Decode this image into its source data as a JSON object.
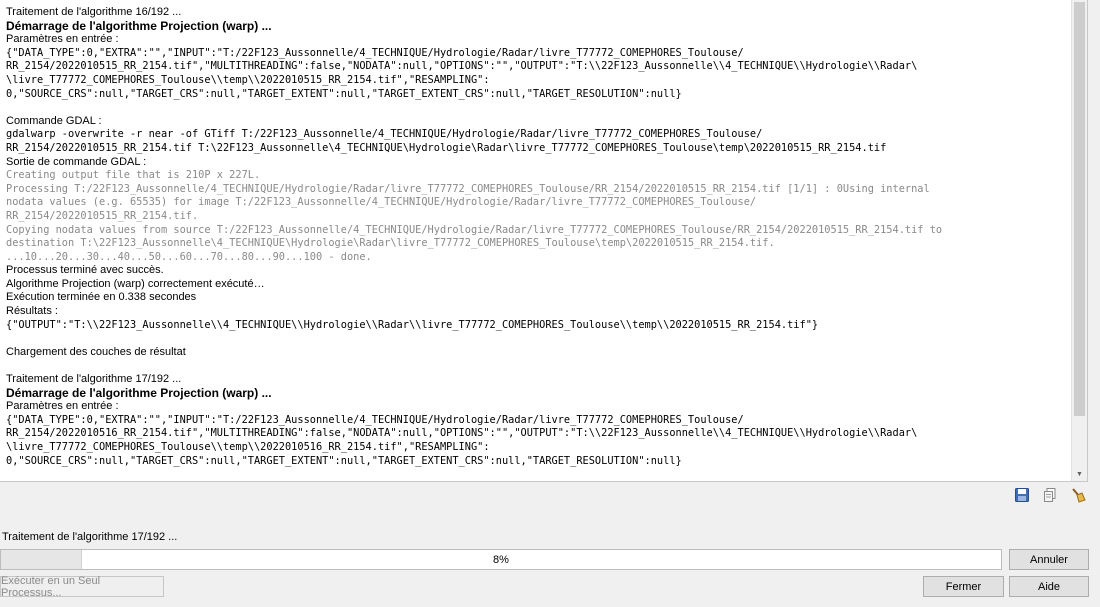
{
  "log": {
    "lines": [
      {
        "t": "Traitement de l'algorithme 16/192 ...",
        "s": "text"
      },
      {
        "t": "Démarrage de l'algorithme Projection (warp) ...",
        "s": "head"
      },
      {
        "t": "Paramètres en entrée :",
        "s": "text"
      },
      {
        "t": "{\"DATA_TYPE\":0,\"EXTRA\":\"\",\"INPUT\":\"T:/22F123_Aussonnelle/4_TECHNIQUE/Hydrologie/Radar/livre_T77772_COMEPHORES_Toulouse/",
        "s": "mono"
      },
      {
        "t": "RR_2154/2022010515_RR_2154.tif\",\"MULTITHREADING\":false,\"NODATA\":null,\"OPTIONS\":\"\",\"OUTPUT\":\"T:\\\\22F123_Aussonnelle\\\\4_TECHNIQUE\\\\Hydrologie\\\\Radar\\",
        "s": "mono"
      },
      {
        "t": "\\livre_T77772_COMEPHORES_Toulouse\\\\temp\\\\2022010515_RR_2154.tif\",\"RESAMPLING\":",
        "s": "mono"
      },
      {
        "t": "0,\"SOURCE_CRS\":null,\"TARGET_CRS\":null,\"TARGET_EXTENT\":null,\"TARGET_EXTENT_CRS\":null,\"TARGET_RESOLUTION\":null}",
        "s": "mono"
      },
      {
        "t": "",
        "s": "blank"
      },
      {
        "t": "Commande GDAL :",
        "s": "text"
      },
      {
        "t": "gdalwarp -overwrite -r near -of GTiff T:/22F123_Aussonnelle/4_TECHNIQUE/Hydrologie/Radar/livre_T77772_COMEPHORES_Toulouse/",
        "s": "mono"
      },
      {
        "t": "RR_2154/2022010515_RR_2154.tif T:\\22F123_Aussonnelle\\4_TECHNIQUE\\Hydrologie\\Radar\\livre_T77772_COMEPHORES_Toulouse\\temp\\2022010515_RR_2154.tif",
        "s": "mono"
      },
      {
        "t": "Sortie de commande GDAL :",
        "s": "text"
      },
      {
        "t": "Creating output file that is 210P x 227L.",
        "s": "gray"
      },
      {
        "t": "Processing T:/22F123_Aussonnelle/4_TECHNIQUE/Hydrologie/Radar/livre_T77772_COMEPHORES_Toulouse/RR_2154/2022010515_RR_2154.tif [1/1] : 0Using internal",
        "s": "gray"
      },
      {
        "t": "nodata values (e.g. 65535) for image T:/22F123_Aussonnelle/4_TECHNIQUE/Hydrologie/Radar/livre_T77772_COMEPHORES_Toulouse/",
        "s": "gray"
      },
      {
        "t": "RR_2154/2022010515_RR_2154.tif.",
        "s": "gray"
      },
      {
        "t": "Copying nodata values from source T:/22F123_Aussonnelle/4_TECHNIQUE/Hydrologie/Radar/livre_T77772_COMEPHORES_Toulouse/RR_2154/2022010515_RR_2154.tif to",
        "s": "gray"
      },
      {
        "t": "destination T:\\22F123_Aussonnelle\\4_TECHNIQUE\\Hydrologie\\Radar\\livre_T77772_COMEPHORES_Toulouse\\temp\\2022010515_RR_2154.tif.",
        "s": "gray"
      },
      {
        "t": "...10...20...30...40...50...60...70...80...90...100 - done.",
        "s": "gray"
      },
      {
        "t": "Processus terminé avec succès.",
        "s": "text"
      },
      {
        "t": "Algorithme Projection (warp) correctement exécuté…",
        "s": "text"
      },
      {
        "t": "Exécution terminée en 0.338 secondes",
        "s": "text"
      },
      {
        "t": "Résultats :",
        "s": "text"
      },
      {
        "t": "{\"OUTPUT\":\"T:\\\\22F123_Aussonnelle\\\\4_TECHNIQUE\\\\Hydrologie\\\\Radar\\\\livre_T77772_COMEPHORES_Toulouse\\\\temp\\\\2022010515_RR_2154.tif\"}",
        "s": "mono"
      },
      {
        "t": "",
        "s": "blank"
      },
      {
        "t": "Chargement des couches de résultat",
        "s": "text"
      },
      {
        "t": "",
        "s": "blank"
      },
      {
        "t": "Traitement de l'algorithme 17/192 ...",
        "s": "text"
      },
      {
        "t": "Démarrage de l'algorithme Projection (warp) ...",
        "s": "head"
      },
      {
        "t": "Paramètres en entrée :",
        "s": "text"
      },
      {
        "t": "{\"DATA_TYPE\":0,\"EXTRA\":\"\",\"INPUT\":\"T:/22F123_Aussonnelle/4_TECHNIQUE/Hydrologie/Radar/livre_T77772_COMEPHORES_Toulouse/",
        "s": "mono"
      },
      {
        "t": "RR_2154/2022010516_RR_2154.tif\",\"MULTITHREADING\":false,\"NODATA\":null,\"OPTIONS\":\"\",\"OUTPUT\":\"T:\\\\22F123_Aussonnelle\\\\4_TECHNIQUE\\\\Hydrologie\\\\Radar\\",
        "s": "mono"
      },
      {
        "t": "\\livre_T77772_COMEPHORES_Toulouse\\\\temp\\\\2022010516_RR_2154.tif\",\"RESAMPLING\":",
        "s": "mono"
      },
      {
        "t": "0,\"SOURCE_CRS\":null,\"TARGET_CRS\":null,\"TARGET_EXTENT\":null,\"TARGET_EXTENT_CRS\":null,\"TARGET_RESOLUTION\":null}",
        "s": "mono"
      }
    ]
  },
  "toolbar": {
    "icons": [
      "save-icon",
      "copy-icon",
      "clear-icon"
    ]
  },
  "status": {
    "label": "Traitement de l'algorithme 17/192 ..."
  },
  "progress": {
    "percent": 8,
    "label": "8%"
  },
  "buttons": {
    "cancel": "Annuler",
    "close": "Fermer",
    "help": "Aide",
    "batch": "Exécuter en un Seul Processus..."
  }
}
